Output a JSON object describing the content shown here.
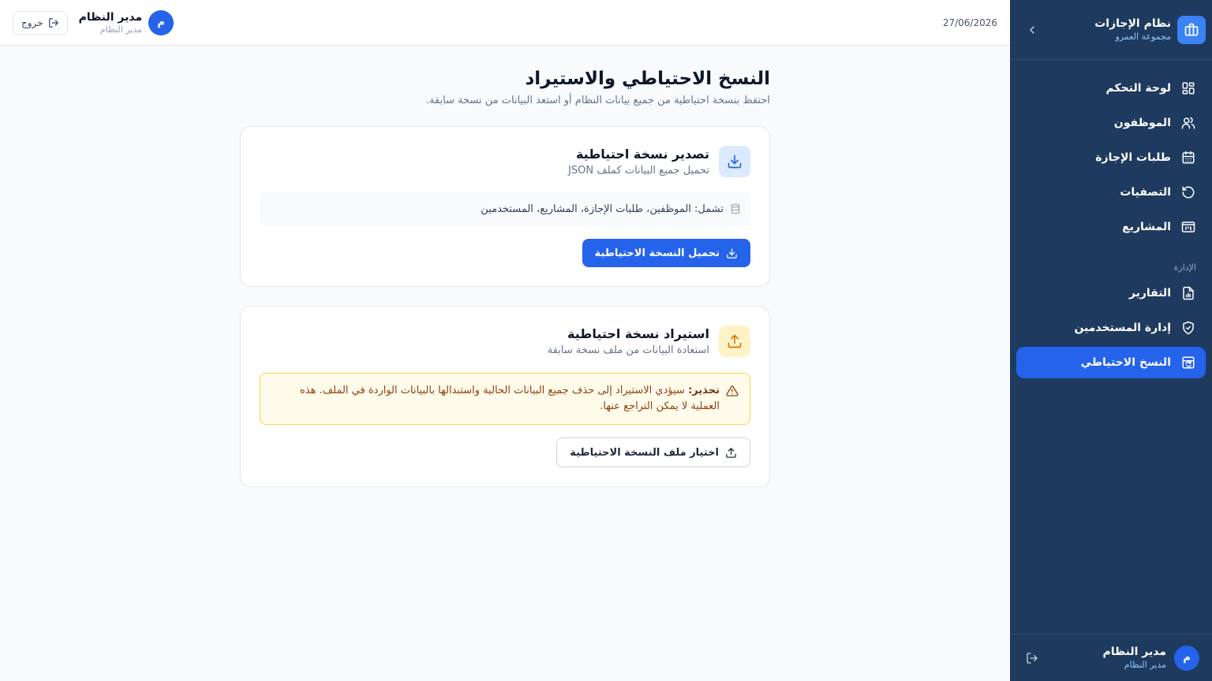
{
  "sidebar": {
    "brand_title": "نظام الإجازات",
    "brand_subtitle": "مجموعة العمرو",
    "items": [
      {
        "label": "لوحة التحكم",
        "icon": "dashboard-icon"
      },
      {
        "label": "الموظفون",
        "icon": "users-icon"
      },
      {
        "label": "طلبات الإجازة",
        "icon": "calendar-icon"
      },
      {
        "label": "التصفيات",
        "icon": "rotate-icon"
      },
      {
        "label": "المشاريع",
        "icon": "projects-icon"
      }
    ],
    "admin_section_label": "الإدارة",
    "admin_items": [
      {
        "label": "التقارير",
        "icon": "report-icon"
      },
      {
        "label": "إدارة المستخدمين",
        "icon": "shield-icon"
      },
      {
        "label": "النسخ الاحتياطي",
        "icon": "backup-icon",
        "active": true
      }
    ],
    "footer": {
      "avatar_initial": "م",
      "user_name": "مدير النظام",
      "user_role": "مدير النظام"
    }
  },
  "topbar": {
    "date": "27/06/2026",
    "avatar_initial": "م",
    "user_name": "مدير النظام",
    "user_role": "مدير النظام",
    "logout_label": "خروج"
  },
  "page": {
    "title": "النسخ الاحتياطي والاستيراد",
    "subtitle": "احتفظ بنسخة احتياطية من جميع بيانات النظام أو استعد البيانات من نسخة سابقة."
  },
  "export_card": {
    "title": "تصدير نسخة احتياطية",
    "description": "تحميل جميع البيانات كملف JSON",
    "includes_text": "تشمل: الموظفين، طلبات الإجازة، المشاريع، المستخدمين",
    "button_label": "تحميل النسخة الاحتياطية"
  },
  "import_card": {
    "title": "استيراد نسخة احتياطية",
    "description": "استعادة البيانات من ملف نسخة سابقة",
    "warning_label": "تحذير:",
    "warning_text": "سيؤدي الاستيراد إلى حذف جميع البيانات الحالية واستبدالها بالبيانات الواردة في الملف. هذه العملية لا يمكن التراجع عنها.",
    "button_label": "اختيار ملف النسخة الاحتياطية"
  },
  "colors": {
    "sidebar_bg": "#1e3a5f",
    "accent": "#2563eb",
    "warning_bg": "#fffbeb",
    "warning_border": "#fcd34d"
  }
}
